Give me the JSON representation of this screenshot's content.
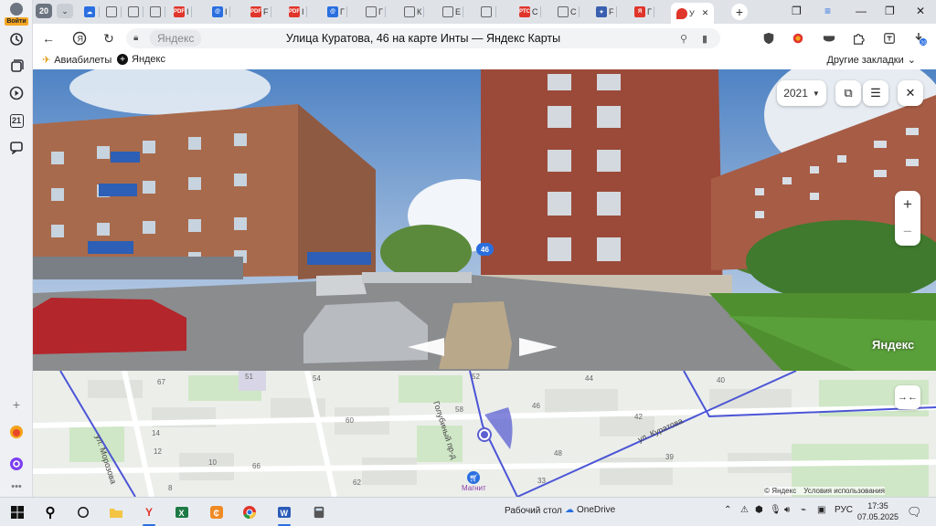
{
  "sidebar": {
    "login_label": "Войти",
    "items": [
      {
        "icon": "history-icon"
      },
      {
        "icon": "collections-icon"
      },
      {
        "icon": "play-icon"
      },
      {
        "icon": "calendar-icon",
        "label": "21"
      },
      {
        "icon": "messenger-icon"
      }
    ],
    "bottom_items": [
      {
        "icon": "add-icon"
      },
      {
        "icon": "yandex-market-icon"
      },
      {
        "icon": "alice-icon"
      },
      {
        "icon": "more-icon"
      }
    ]
  },
  "tabs": {
    "count": "20",
    "items": [
      {
        "label": "",
        "icon": "cloud-icon",
        "color": "#2a6fe0"
      },
      {
        "label": "",
        "icon": "doc-icon",
        "color": "#555"
      },
      {
        "label": "",
        "icon": "doc-icon",
        "color": "#555"
      },
      {
        "label": "",
        "icon": "doc-icon",
        "color": "#555"
      },
      {
        "label": "I",
        "icon": "pdf-icon",
        "color": "#e0352b"
      },
      {
        "label": "I",
        "icon": "mail-icon",
        "color": "#2a6fe0"
      },
      {
        "label": "F",
        "icon": "pdf-icon",
        "color": "#e0352b"
      },
      {
        "label": "I",
        "icon": "pdf-icon",
        "color": "#e0352b"
      },
      {
        "label": "Г",
        "icon": "mail-icon",
        "color": "#2a6fe0"
      },
      {
        "label": "Г",
        "icon": "doc-icon",
        "color": "#555"
      },
      {
        "label": "К",
        "icon": "doc-icon",
        "color": "#555"
      },
      {
        "label": "Е",
        "icon": "doc-icon",
        "color": "#555"
      },
      {
        "label": "",
        "icon": "doc-icon",
        "color": "#555"
      },
      {
        "label": "С",
        "icon": "rtc-icon",
        "color": "#e0352b"
      },
      {
        "label": "С",
        "icon": "doc-icon",
        "color": "#555"
      },
      {
        "label": "F",
        "icon": "emblem-icon",
        "color": "#3a5fb0"
      },
      {
        "label": "Г",
        "icon": "yandex-icon",
        "color": "#e0352b"
      }
    ],
    "active_label": "У",
    "active_icon": "map-pin-icon"
  },
  "window": {
    "minimize": "—",
    "restore": "❐",
    "close": "✕"
  },
  "address": {
    "site": "Яндекс",
    "title": "Улица Куратова, 46 на карте Инты — Яндекс Карты"
  },
  "bookmarks": {
    "items": [
      {
        "label": "Авиабилеты",
        "icon": "plane-icon"
      },
      {
        "label": "Яндекс",
        "icon": "plus-circle-icon"
      }
    ],
    "other": "Другие закладки"
  },
  "panorama": {
    "year": "2021",
    "brand": "Яндекс",
    "house_number": "46"
  },
  "map": {
    "house_numbers": [
      "67",
      "51",
      "54",
      "52",
      "44",
      "40",
      "60",
      "58",
      "46",
      "42",
      "14",
      "12",
      "48",
      "39",
      "10",
      "66",
      "62",
      "8",
      "33"
    ],
    "streets": {
      "kuratova": "ул. Куратова",
      "golubinny": "Голубиный пр-д",
      "morozova": "ул. Морозова"
    },
    "poi": "Магнит",
    "footer_brand": "© Яндекс",
    "footer_terms": "Условия использования"
  },
  "taskbar": {
    "desktop": "Рабочий стол",
    "onedrive": "OneDrive",
    "lang": "РУС",
    "time": "17:35",
    "date": "07.05.2025"
  }
}
